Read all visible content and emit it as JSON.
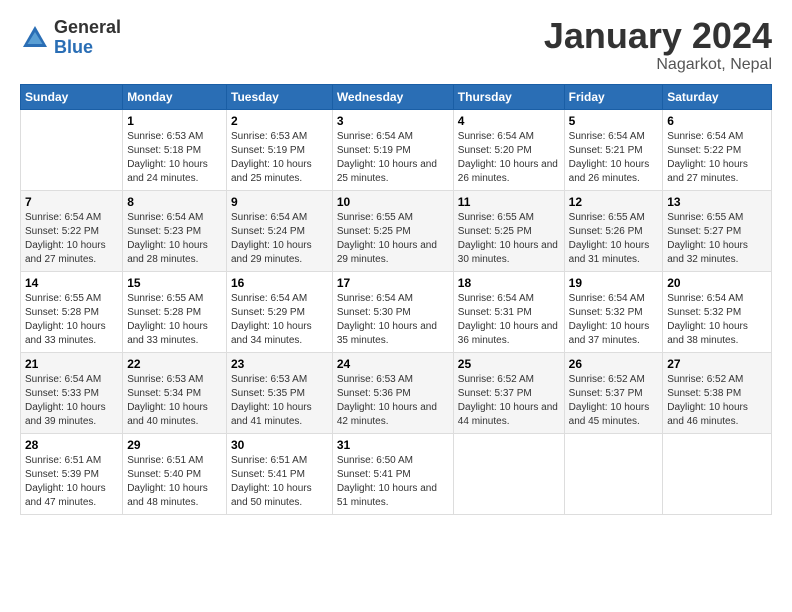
{
  "logo": {
    "general": "General",
    "blue": "Blue"
  },
  "title": "January 2024",
  "location": "Nagarkot, Nepal",
  "days_of_week": [
    "Sunday",
    "Monday",
    "Tuesday",
    "Wednesday",
    "Thursday",
    "Friday",
    "Saturday"
  ],
  "weeks": [
    [
      {
        "day": "",
        "info": ""
      },
      {
        "day": "1",
        "info": "Sunrise: 6:53 AM\nSunset: 5:18 PM\nDaylight: 10 hours\nand 24 minutes."
      },
      {
        "day": "2",
        "info": "Sunrise: 6:53 AM\nSunset: 5:19 PM\nDaylight: 10 hours\nand 25 minutes."
      },
      {
        "day": "3",
        "info": "Sunrise: 6:54 AM\nSunset: 5:19 PM\nDaylight: 10 hours\nand 25 minutes."
      },
      {
        "day": "4",
        "info": "Sunrise: 6:54 AM\nSunset: 5:20 PM\nDaylight: 10 hours\nand 26 minutes."
      },
      {
        "day": "5",
        "info": "Sunrise: 6:54 AM\nSunset: 5:21 PM\nDaylight: 10 hours\nand 26 minutes."
      },
      {
        "day": "6",
        "info": "Sunrise: 6:54 AM\nSunset: 5:22 PM\nDaylight: 10 hours\nand 27 minutes."
      }
    ],
    [
      {
        "day": "7",
        "info": ""
      },
      {
        "day": "8",
        "info": "Sunrise: 6:54 AM\nSunset: 5:23 PM\nDaylight: 10 hours\nand 28 minutes."
      },
      {
        "day": "9",
        "info": "Sunrise: 6:54 AM\nSunset: 5:24 PM\nDaylight: 10 hours\nand 29 minutes."
      },
      {
        "day": "10",
        "info": "Sunrise: 6:55 AM\nSunset: 5:25 PM\nDaylight: 10 hours\nand 29 minutes."
      },
      {
        "day": "11",
        "info": "Sunrise: 6:55 AM\nSunset: 5:25 PM\nDaylight: 10 hours\nand 30 minutes."
      },
      {
        "day": "12",
        "info": "Sunrise: 6:55 AM\nSunset: 5:26 PM\nDaylight: 10 hours\nand 31 minutes."
      },
      {
        "day": "13",
        "info": "Sunrise: 6:55 AM\nSunset: 5:27 PM\nDaylight: 10 hours\nand 32 minutes."
      }
    ],
    [
      {
        "day": "14",
        "info": ""
      },
      {
        "day": "15",
        "info": "Sunrise: 6:55 AM\nSunset: 5:28 PM\nDaylight: 10 hours\nand 33 minutes."
      },
      {
        "day": "16",
        "info": "Sunrise: 6:54 AM\nSunset: 5:29 PM\nDaylight: 10 hours\nand 34 minutes."
      },
      {
        "day": "17",
        "info": "Sunrise: 6:54 AM\nSunset: 5:30 PM\nDaylight: 10 hours\nand 35 minutes."
      },
      {
        "day": "18",
        "info": "Sunrise: 6:54 AM\nSunset: 5:31 PM\nDaylight: 10 hours\nand 36 minutes."
      },
      {
        "day": "19",
        "info": "Sunrise: 6:54 AM\nSunset: 5:32 PM\nDaylight: 10 hours\nand 37 minutes."
      },
      {
        "day": "20",
        "info": "Sunrise: 6:54 AM\nSunset: 5:32 PM\nDaylight: 10 hours\nand 38 minutes."
      }
    ],
    [
      {
        "day": "21",
        "info": ""
      },
      {
        "day": "22",
        "info": "Sunrise: 6:53 AM\nSunset: 5:34 PM\nDaylight: 10 hours\nand 40 minutes."
      },
      {
        "day": "23",
        "info": "Sunrise: 6:53 AM\nSunset: 5:35 PM\nDaylight: 10 hours\nand 41 minutes."
      },
      {
        "day": "24",
        "info": "Sunrise: 6:53 AM\nSunset: 5:36 PM\nDaylight: 10 hours\nand 42 minutes."
      },
      {
        "day": "25",
        "info": "Sunrise: 6:52 AM\nSunset: 5:37 PM\nDaylight: 10 hours\nand 44 minutes."
      },
      {
        "day": "26",
        "info": "Sunrise: 6:52 AM\nSunset: 5:37 PM\nDaylight: 10 hours\nand 45 minutes."
      },
      {
        "day": "27",
        "info": "Sunrise: 6:52 AM\nSunset: 5:38 PM\nDaylight: 10 hours\nand 46 minutes."
      }
    ],
    [
      {
        "day": "28",
        "info": "Sunrise: 6:51 AM\nSunset: 5:39 PM\nDaylight: 10 hours\nand 47 minutes."
      },
      {
        "day": "29",
        "info": "Sunrise: 6:51 AM\nSunset: 5:40 PM\nDaylight: 10 hours\nand 48 minutes."
      },
      {
        "day": "30",
        "info": "Sunrise: 6:51 AM\nSunset: 5:41 PM\nDaylight: 10 hours\nand 50 minutes."
      },
      {
        "day": "31",
        "info": "Sunrise: 6:50 AM\nSunset: 5:41 PM\nDaylight: 10 hours\nand 51 minutes."
      },
      {
        "day": "",
        "info": ""
      },
      {
        "day": "",
        "info": ""
      },
      {
        "day": "",
        "info": ""
      }
    ]
  ],
  "week1_sun_info": "Sunrise: 6:54 AM\nSunset: 5:22 PM\nDaylight: 10 hours\nand 27 minutes.",
  "week2_sun_info": "Sunrise: 6:54 AM\nSunset: 5:22 PM\nDaylight: 10 hours\nand 27 minutes.",
  "week3_sun_info": "Sunrise: 6:55 AM\nSunset: 5:28 PM\nDaylight: 10 hours\nand 33 minutes.",
  "week4_sun_info": "Sunrise: 6:54 AM\nSunset: 5:33 PM\nDaylight: 10 hours\nand 39 minutes."
}
